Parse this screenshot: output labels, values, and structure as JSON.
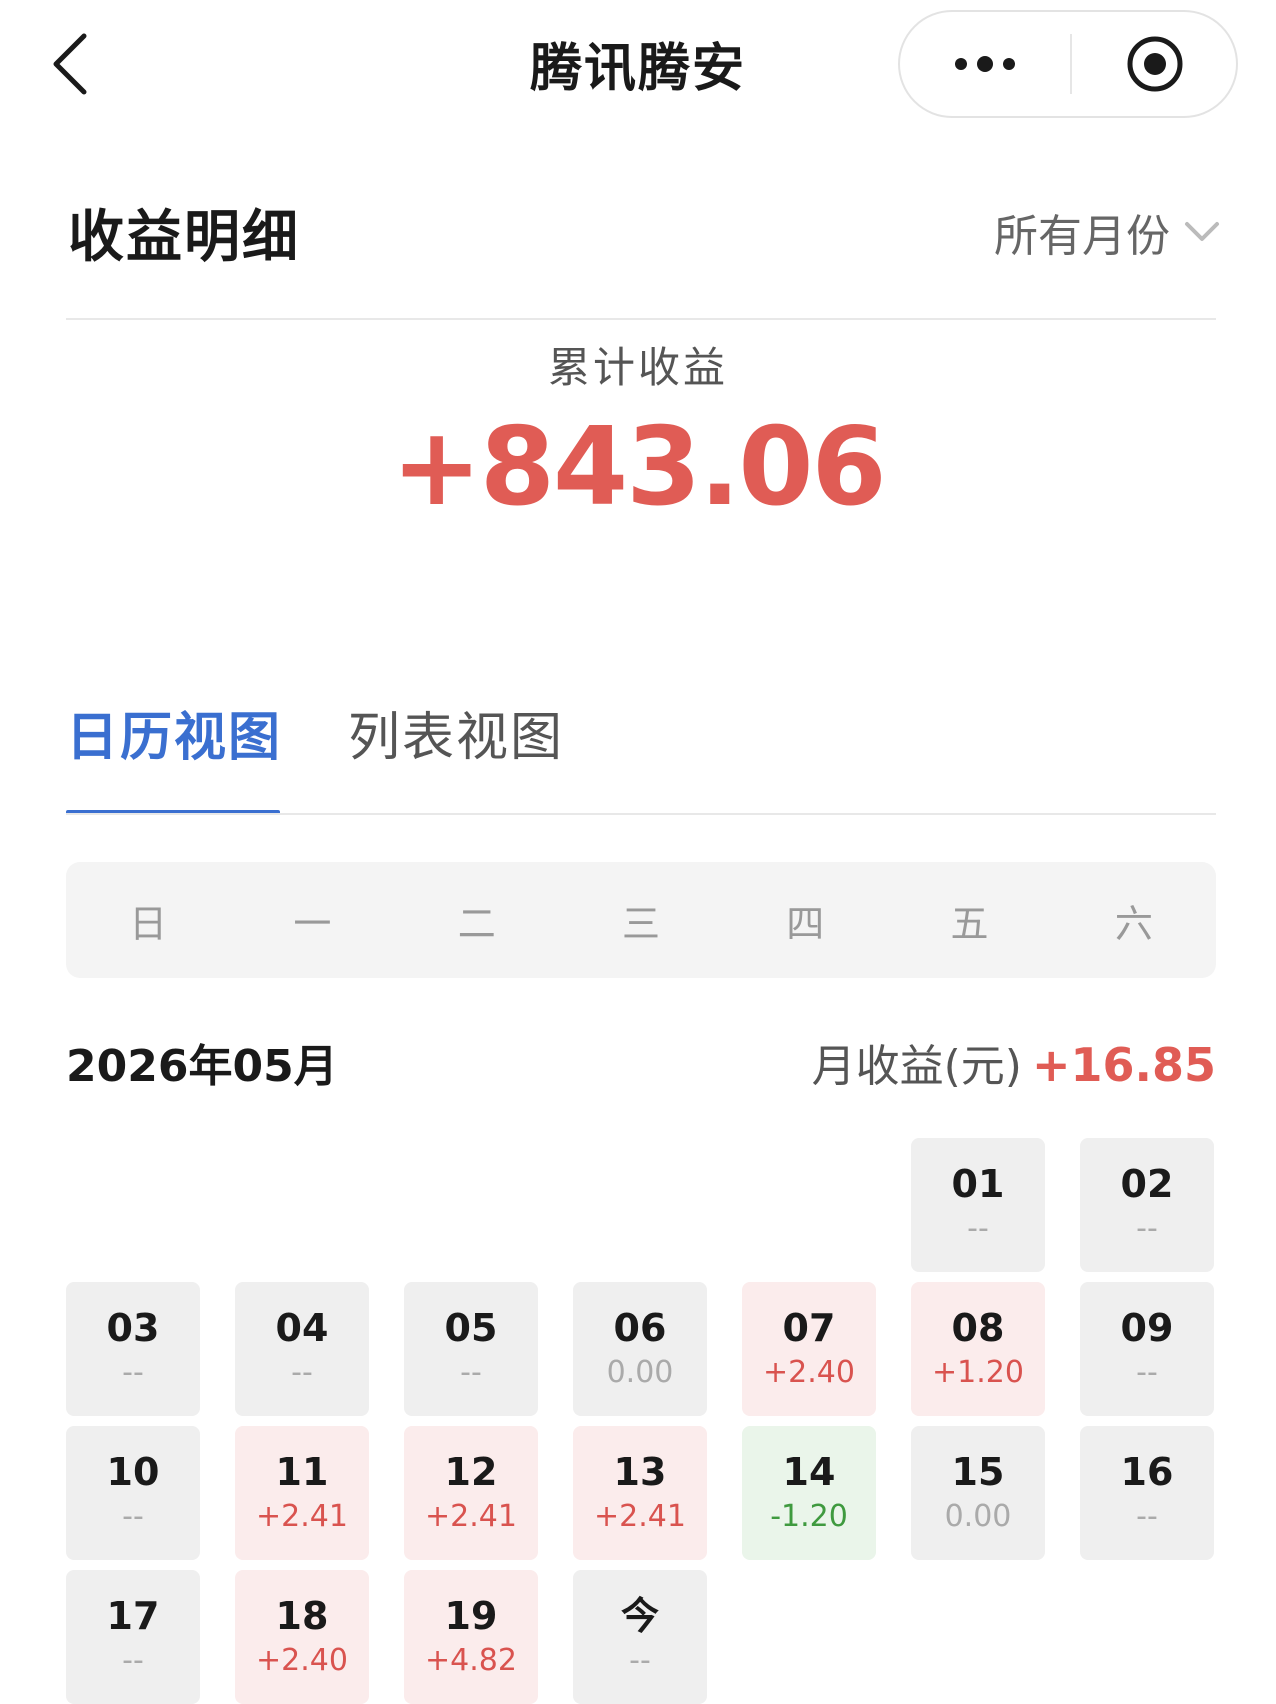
{
  "nav": {
    "title": "腾讯腾安"
  },
  "header": {
    "title": "收益明细",
    "month_filter": "所有月份"
  },
  "summary": {
    "label": "累计收益",
    "value": "+843.06"
  },
  "tabs": [
    {
      "label": "日历视图",
      "active": true
    },
    {
      "label": "列表视图",
      "active": false
    }
  ],
  "weekdays": [
    "日",
    "一",
    "二",
    "三",
    "四",
    "五",
    "六"
  ],
  "month": {
    "label": "2026年05月",
    "summary_label": "月收益(元)",
    "summary_value": "+16.85"
  },
  "colors": {
    "accent": "#3a6fd0",
    "gain": "#e05c55",
    "loss": "#3f9a3f"
  },
  "calendar": [
    {
      "day": "01",
      "value": "--",
      "kind": "neutral"
    },
    {
      "day": "02",
      "value": "--",
      "kind": "neutral"
    },
    {
      "day": "03",
      "value": "--",
      "kind": "neutral"
    },
    {
      "day": "04",
      "value": "--",
      "kind": "neutral"
    },
    {
      "day": "05",
      "value": "--",
      "kind": "neutral"
    },
    {
      "day": "06",
      "value": "0.00",
      "kind": "neutral"
    },
    {
      "day": "07",
      "value": "+2.40",
      "kind": "gain"
    },
    {
      "day": "08",
      "value": "+1.20",
      "kind": "gain"
    },
    {
      "day": "09",
      "value": "--",
      "kind": "neutral"
    },
    {
      "day": "10",
      "value": "--",
      "kind": "neutral"
    },
    {
      "day": "11",
      "value": "+2.41",
      "kind": "gain"
    },
    {
      "day": "12",
      "value": "+2.41",
      "kind": "gain"
    },
    {
      "day": "13",
      "value": "+2.41",
      "kind": "gain"
    },
    {
      "day": "14",
      "value": "-1.20",
      "kind": "loss"
    },
    {
      "day": "15",
      "value": "0.00",
      "kind": "neutral"
    },
    {
      "day": "16",
      "value": "--",
      "kind": "neutral"
    },
    {
      "day": "17",
      "value": "--",
      "kind": "neutral"
    },
    {
      "day": "18",
      "value": "+2.40",
      "kind": "gain"
    },
    {
      "day": "19",
      "value": "+4.82",
      "kind": "gain"
    },
    {
      "day": "今",
      "value": "--",
      "kind": "neutral"
    }
  ]
}
